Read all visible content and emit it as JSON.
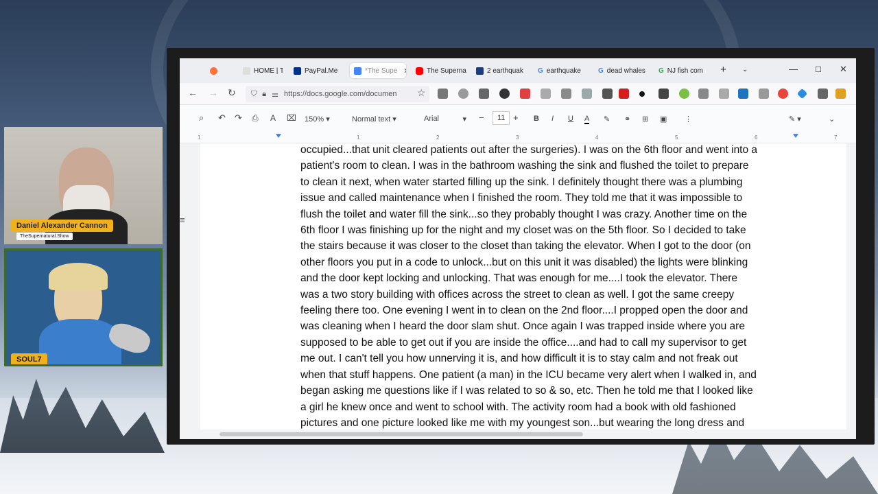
{
  "browser": {
    "tabs": [
      {
        "label": "",
        "icon": "firefox-icon",
        "color": "#ff7139"
      },
      {
        "label": "HOME | The",
        "icon": "site-icon",
        "color": "#cccccc"
      },
      {
        "label": "PayPal.Me",
        "icon": "paypal-icon",
        "color": "#003087"
      },
      {
        "label": "*The Supe",
        "icon": "docs-icon",
        "color": "#4285f4",
        "active": true
      },
      {
        "label": "The Superna",
        "icon": "youtube-icon",
        "color": "#ff0000"
      },
      {
        "label": "2 earthquak",
        "icon": "fox-icon",
        "color": "#1f3d7a"
      },
      {
        "label": "earthquake",
        "icon": "google-icon",
        "color": "#4285f4"
      },
      {
        "label": "dead whales",
        "icon": "google-icon",
        "color": "#4285f4"
      },
      {
        "label": "NJ fish com",
        "icon": "google-icon",
        "color": "#34a853"
      }
    ],
    "url": "https://docs.google.com/documen"
  },
  "docs_toolbar": {
    "zoom": "150%",
    "style": "Normal text",
    "font": "Arial",
    "font_size": "11"
  },
  "ruler": [
    "1",
    "1",
    "2",
    "3",
    "4",
    "5",
    "6",
    "7"
  ],
  "document": {
    "lines": [
      "occupied...that unit cleared patients out after the surgeries). I was on the 6th floor and went into a",
      "patient's room to clean. I was in the bathroom washing the sink and flushed the toilet to prepare",
      "to clean it next, when water started filling up the sink. I definitely thought there was a plumbing",
      "issue and called maintenance when I finished the room. They told me that it was impossible to",
      "flush the toilet and water fill the sink...so they probably thought I was crazy. Another time on the",
      "6th floor I was finishing up for the night and my closet was on the 5th floor. So I decided to take",
      "the stairs because it was closer to the closet than taking the elevator. When I got to the door (on",
      "other floors you put in a code to unlock...but on this unit it was disabled) the lights were blinking",
      "and the door kept locking and unlocking. That was enough for me....I took the elevator. There",
      "was a two story building with offices across the street to clean as well. I got the same creepy",
      "feeling there too. One evening I went in to clean on the 2nd floor....I propped open the door and",
      "was cleaning when I heard the door slam shut. Once again I was trapped inside where you are",
      "supposed to be able to get out if you are inside the office....and had to call my supervisor to get",
      "me out. I can't tell you how unnerving it is, and how difficult it is to stay calm and not freak out",
      "when that stuff happens. One patient (a man) in the ICU became very alert when I walked in, and",
      "began asking me questions like if I was related to so & so, etc. Then he told me that I looked like",
      "a girl he knew once and went to school with. The activity room had a book with old fashioned",
      "pictures and one picture looked like me with my youngest son...but wearing the long dress and"
    ]
  },
  "cams": {
    "host1_name": "Daniel Alexander Cannon",
    "host1_show": "TheSupernatural.Show",
    "host2_name": "SOUL7"
  }
}
